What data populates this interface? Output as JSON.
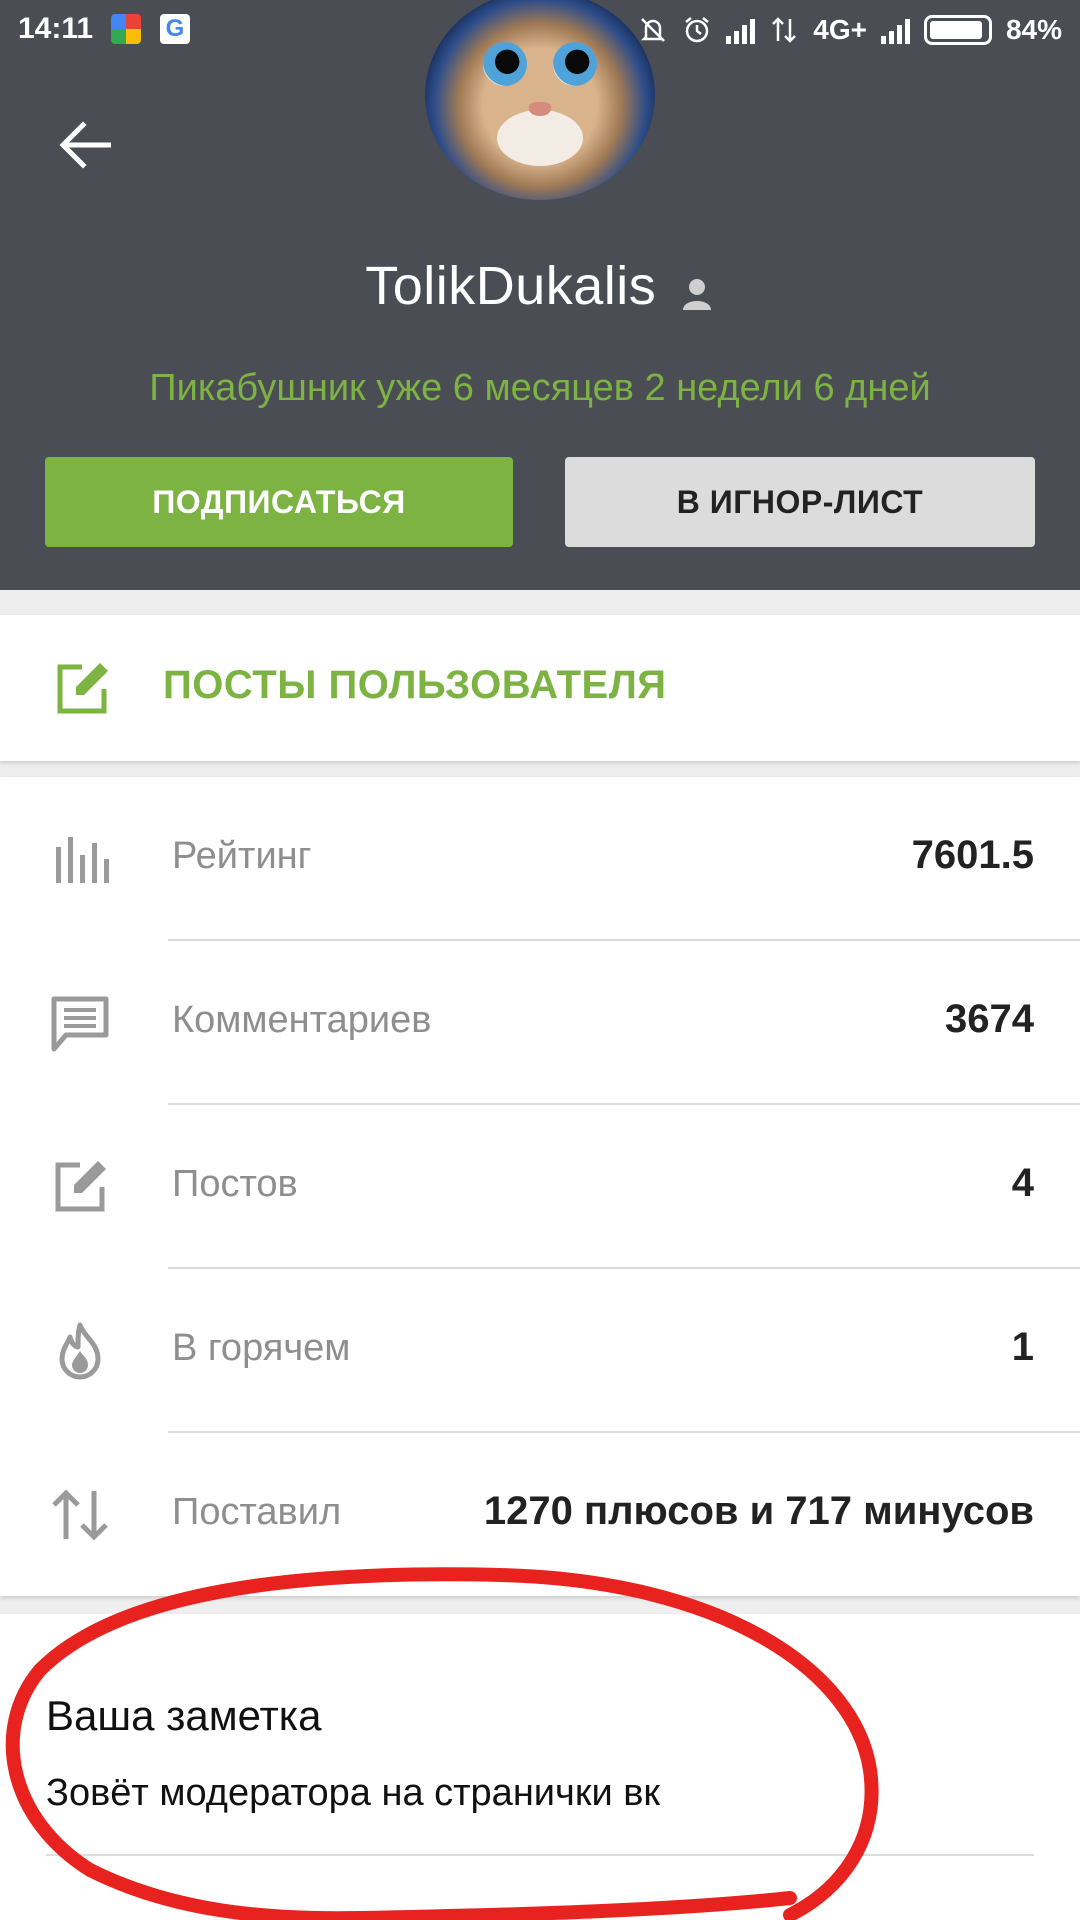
{
  "status_bar": {
    "time": "14:11",
    "google_icon": "G",
    "network": "4G+",
    "battery": "84%"
  },
  "header": {
    "username": "TolikDukalis",
    "member_since": "Пикабушник уже 6 месяцев 2 недели 6 дней",
    "subscribe_label": "ПОДПИСАТЬСЯ",
    "ignore_label": "В ИГНОР-ЛИСТ"
  },
  "posts_link": {
    "label": "ПОСТЫ ПОЛЬЗОВАТЕЛЯ"
  },
  "stats": [
    {
      "icon": "bar-chart-icon",
      "label": "Рейтинг",
      "value": "7601.5"
    },
    {
      "icon": "comment-icon",
      "label": "Комментариев",
      "value": "3674"
    },
    {
      "icon": "edit-icon",
      "label": "Постов",
      "value": "4"
    },
    {
      "icon": "fire-icon",
      "label": "В горячем",
      "value": "1"
    },
    {
      "icon": "swap-vert-icon",
      "label": "Поставил",
      "value": "1270 плюсов и 717 минусов"
    }
  ],
  "note": {
    "title": "Ваша заметка",
    "text": "Зовёт модератора на странички вк"
  },
  "colors": {
    "header_bg": "#4a4d53",
    "accent_green": "#7cb342",
    "ignore_button_bg": "#dcdcdc",
    "annotation_red": "#e8231f"
  }
}
